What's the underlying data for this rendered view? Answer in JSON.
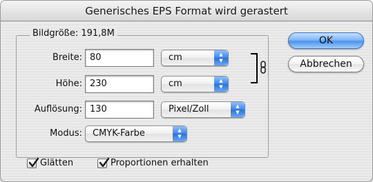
{
  "dialog": {
    "title": "Generisches EPS Format wird gerastert"
  },
  "image_size": {
    "legend": "Bildgröße: 191,8M",
    "width_label": "Breite:",
    "width_value": "80",
    "width_unit": "cm",
    "height_label": "Höhe:",
    "height_value": "230",
    "height_unit": "cm",
    "resolution_label": "Auflösung:",
    "resolution_value": "130",
    "resolution_unit": "Pixel/Zoll",
    "mode_label": "Modus:",
    "mode_value": "CMYK-Farbe"
  },
  "buttons": {
    "ok": "OK",
    "cancel": "Abbrechen"
  },
  "options": {
    "antialias_label": "Glätten",
    "antialias_checked": true,
    "constrain_label": "Proportionen erhalten",
    "constrain_checked": true
  },
  "colors": {
    "accent": "#3b86ec",
    "default_button": "#7fb6f7"
  },
  "icons": {
    "link": "chain-link-icon",
    "popup_arrows": "updown-arrows-icon",
    "check": "checkmark-icon"
  }
}
